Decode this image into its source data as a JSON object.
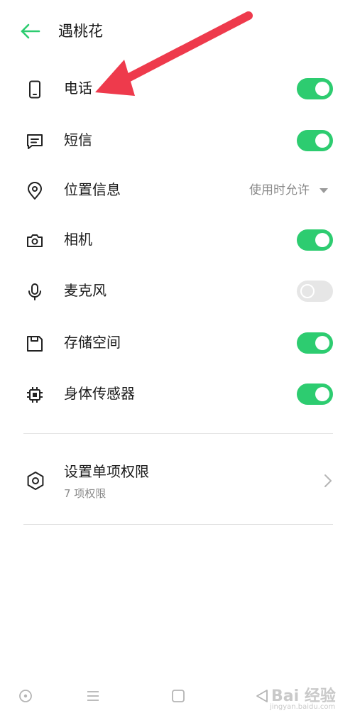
{
  "header": {
    "title": "遇桃花"
  },
  "permissions": [
    {
      "label": "电话",
      "icon": "phone-icon",
      "control": "toggle",
      "on": true
    },
    {
      "label": "短信",
      "icon": "message-icon",
      "control": "toggle",
      "on": true
    },
    {
      "label": "位置信息",
      "icon": "location-icon",
      "control": "dropdown",
      "value": "使用时允许"
    },
    {
      "label": "相机",
      "icon": "camera-icon",
      "control": "toggle",
      "on": true
    },
    {
      "label": "麦克风",
      "icon": "microphone-icon",
      "control": "toggle",
      "on": false
    },
    {
      "label": "存储空间",
      "icon": "storage-icon",
      "control": "toggle",
      "on": true
    },
    {
      "label": "身体传感器",
      "icon": "sensor-icon",
      "control": "toggle",
      "on": true
    }
  ],
  "single_permissions": {
    "title": "设置单项权限",
    "subtitle": "7 项权限"
  },
  "colors": {
    "accent": "#2dcc70",
    "toggle_off": "#e6e6e6",
    "annotation_arrow": "#ee3a4c"
  },
  "watermark": {
    "text": "Bai 经验",
    "sub": "jingyan.baidu.com"
  }
}
